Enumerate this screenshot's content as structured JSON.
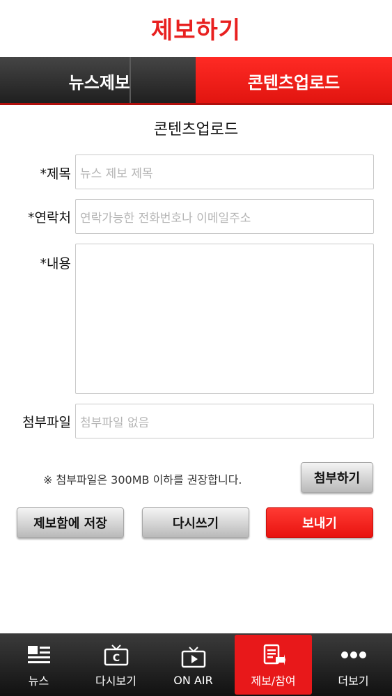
{
  "header": {
    "title": "제보하기"
  },
  "tabs": [
    {
      "label": "뉴스제보",
      "active": false
    },
    {
      "label": "콘텐츠업로드",
      "active": true
    }
  ],
  "form": {
    "section_title": "콘텐츠업로드",
    "title_label": "*제목",
    "title_placeholder": "뉴스 제보 제목",
    "contact_label": "*연락처",
    "contact_placeholder": "연락가능한 전화번호나 이메일주소",
    "content_label": "*내용",
    "content_value": "",
    "attach_label": "첨부파일",
    "attach_placeholder": "첨부파일 없음",
    "note": "※ 첨부파일은 300MB 이하를 권장합니다.",
    "attach_button": "첨부하기",
    "save_button": "제보함에 저장",
    "rewrite_button": "다시쓰기",
    "send_button": "보내기"
  },
  "bottom_nav": [
    {
      "label": "뉴스",
      "icon": "news-list-icon",
      "active": false
    },
    {
      "label": "다시보기",
      "icon": "replay-tv-icon",
      "active": false
    },
    {
      "label": "ON AIR",
      "icon": "live-tv-icon",
      "active": false
    },
    {
      "label": "제보/참여",
      "icon": "report-edit-icon",
      "active": true
    },
    {
      "label": "더보기",
      "icon": "more-dots-icon",
      "active": false
    }
  ],
  "colors": {
    "accent": "#e8201f",
    "tab_dark": "#2a2a2a",
    "nav_bg": "#1e1e1e"
  }
}
